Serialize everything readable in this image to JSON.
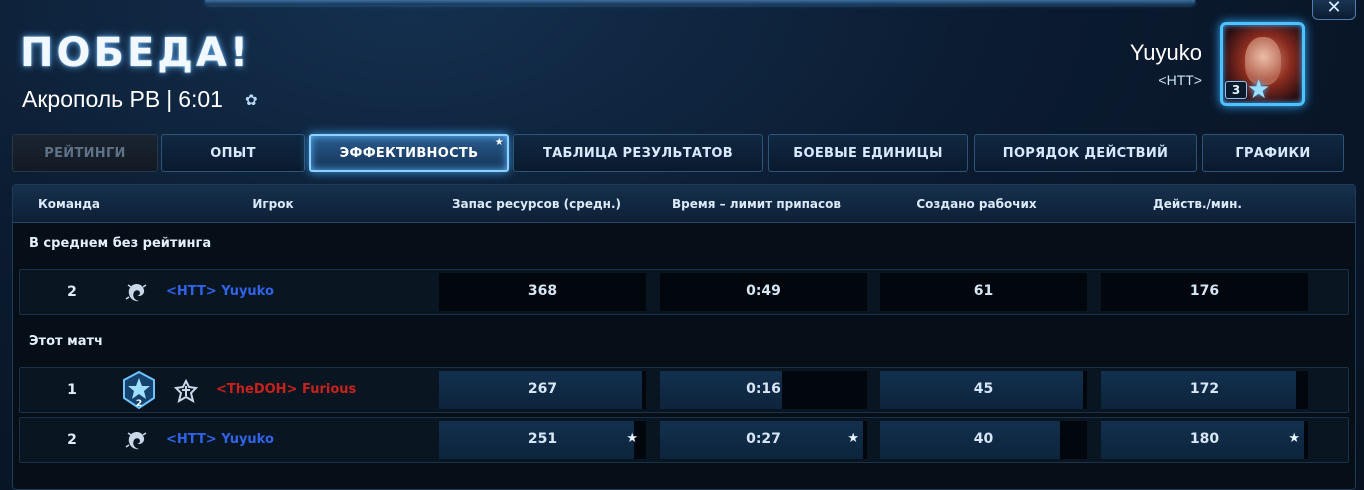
{
  "window": {
    "close_label": "✕"
  },
  "header": {
    "title": "ПОБЕДА!",
    "map_name": "Акрополь РВ",
    "separator": "|",
    "duration": "6:01",
    "gear_icon": "gear-icon"
  },
  "player": {
    "name": "Yuyuko",
    "clan": "<HTT>",
    "level": "3"
  },
  "tabs": [
    {
      "label": "РЕЙТИНГИ",
      "state": "disabled"
    },
    {
      "label": "ОПЫТ",
      "state": "normal"
    },
    {
      "label": "ЭФФЕКТИВНОСТЬ",
      "state": "active",
      "starred": true
    },
    {
      "label": "ТАБЛИЦА РЕЗУЛЬТАТОВ",
      "state": "normal"
    },
    {
      "label": "БОЕВЫЕ ЕДИНИЦЫ",
      "state": "normal"
    },
    {
      "label": "ПОРЯДОК ДЕЙСТВИЙ",
      "state": "normal"
    },
    {
      "label": "ГРАФИКИ",
      "state": "normal"
    }
  ],
  "table": {
    "columns": [
      "Команда",
      "Игрок",
      "Запас ресурсов (средн.)",
      "Время – лимит припасов",
      "Создано рабочих",
      "Действ./мин."
    ],
    "sections": [
      {
        "label": "В среднем без рейтинга",
        "rows": [
          {
            "team": "2",
            "player": "<HTT> Yuyuko",
            "name_color": "#2f63e8",
            "race_icon": "zerg-icon",
            "values": [
              "368",
              "0:49",
              "61",
              "176"
            ],
            "fills": [
              0,
              0,
              0,
              0
            ],
            "stars": [
              false,
              false,
              false,
              false
            ]
          }
        ]
      },
      {
        "label": "Этот матч",
        "rows": [
          {
            "team": "1",
            "player": "<TheDOH> Furious",
            "name_color": "#c8221c",
            "race_icon": "terran-icon",
            "league_icon": "league-badge-icon",
            "values": [
              "267",
              "0:16",
              "45",
              "172"
            ],
            "fills": [
              0.98,
              0.59,
              0.98,
              0.94
            ],
            "stars": [
              false,
              false,
              false,
              false
            ]
          },
          {
            "team": "2",
            "player": "<HTT> Yuyuko",
            "name_color": "#2f63e8",
            "race_icon": "zerg-icon",
            "values": [
              "251",
              "0:27",
              "40",
              "180"
            ],
            "fills": [
              0.94,
              0.98,
              0.87,
              0.98
            ],
            "stars": [
              true,
              true,
              false,
              true
            ]
          }
        ]
      }
    ]
  },
  "colors": {
    "accent": "#8fd0ff",
    "panel_bg": "#060e18",
    "team1": "#c8221c",
    "team2": "#2f63e8"
  }
}
